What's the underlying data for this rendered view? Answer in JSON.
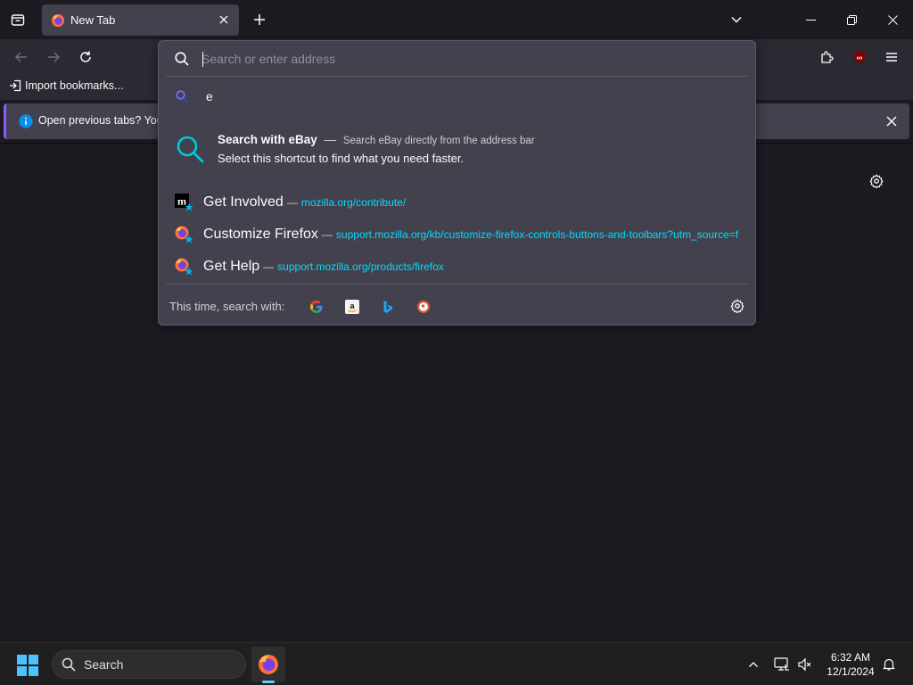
{
  "tab": {
    "title": "New Tab"
  },
  "bookmarks": {
    "import_label": "Import bookmarks..."
  },
  "notification": {
    "text": "Open previous tabs? You c"
  },
  "urlbar": {
    "placeholder": "Search or enter address",
    "query_row": {
      "text": "e"
    },
    "ebay": {
      "title": "Search with eBay",
      "dash": "—",
      "description": "Search eBay directly from the address bar",
      "subtitle": "Select this shortcut to find what you need faster."
    },
    "results": [
      {
        "title": "Get Involved",
        "dash": "—",
        "url": "mozilla.org/contribute/",
        "icon": "mozilla-m-icon"
      },
      {
        "title": "Customize Firefox",
        "dash": "—",
        "url": "support.mozilla.org/kb/customize-firefox-controls-buttons-and-toolbars?utm_source=fi",
        "icon": "firefox-icon"
      },
      {
        "title": "Get Help",
        "dash": "—",
        "url": "support.mozilla.org/products/firefox",
        "icon": "firefox-icon"
      }
    ],
    "one_off": {
      "label": "This time, search with:",
      "engines": [
        "Google",
        "Amazon",
        "Bing",
        "DuckDuckGo"
      ]
    }
  },
  "taskbar": {
    "search_label": "Search",
    "time": "6:32 AM",
    "date": "12/1/2024"
  },
  "colors": {
    "accent": "#00ddff",
    "surface": "#42414d",
    "background": "#1c1b22",
    "notification_accent": "#9059ff"
  }
}
